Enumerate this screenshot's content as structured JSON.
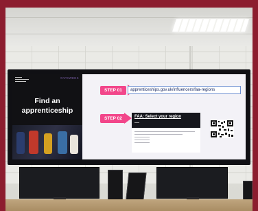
{
  "screen": {
    "hashtag": "#AFEWEEK",
    "left_title": "Find an apprenticeship",
    "step1": {
      "label": "STEP 01",
      "url": "apprenticeships.gov.uk/influencers/faa-regions"
    },
    "step2": {
      "label": "STEP 02"
    },
    "form": {
      "title": "FAA: Select your region"
    }
  },
  "colors": {
    "frame": "#8c1d2f",
    "accent": "#f2468a",
    "link": "#1a2b63"
  }
}
